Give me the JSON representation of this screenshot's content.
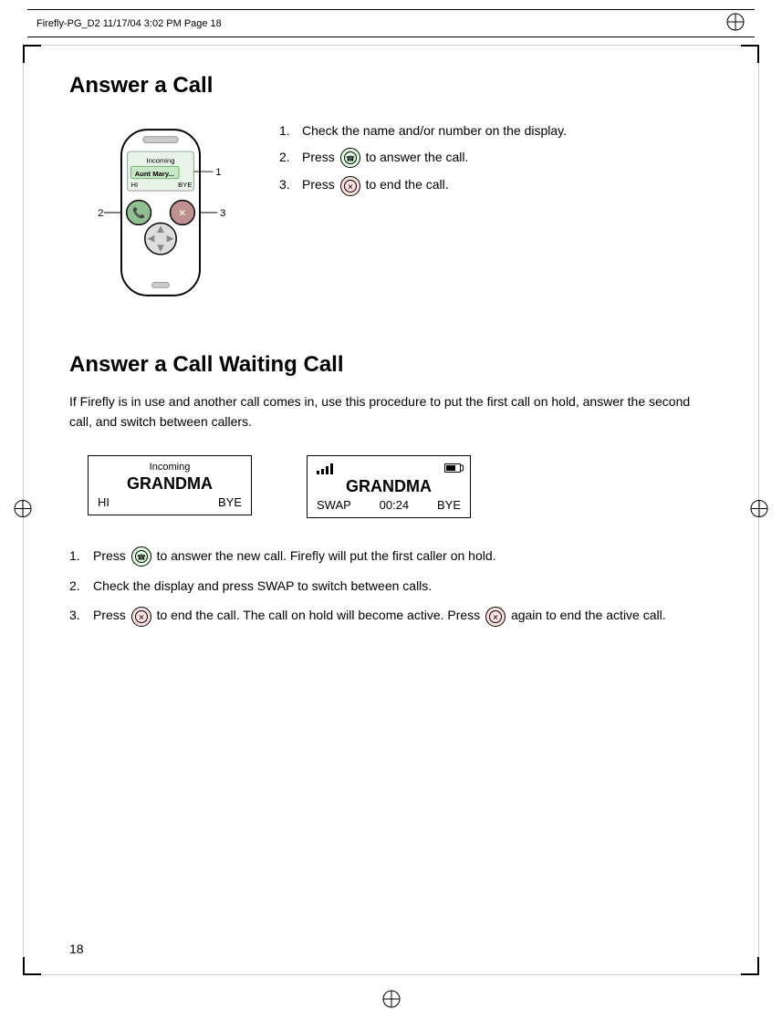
{
  "header": {
    "text": "Firefly-PG_D2  11/17/04  3:02 PM  Page 18"
  },
  "section1": {
    "title": "Answer a Call",
    "step1": "Check the name and/or number on the display.",
    "step2_prefix": "Press",
    "step2_suffix": "to answer the call.",
    "step3_prefix": "Press",
    "step3_suffix": "to end the call."
  },
  "section2": {
    "title": "Answer a Call Waiting Call",
    "description": "If Firefly is in use and another call comes in, use this procedure to put the first call on hold, answer the second call, and switch between callers.",
    "screen1": {
      "label": "Incoming",
      "name": "GRANDMA",
      "left": "HI",
      "right": "BYE"
    },
    "screen2": {
      "name": "GRANDMA",
      "time": "00:24",
      "swap": "SWAP",
      "bye": "BYE"
    },
    "step1_prefix": "Press",
    "step1_suffix": "to answer the new call. Firefly will put the first caller on hold.",
    "step2": "Check the display and press SWAP to switch between calls.",
    "step3_prefix": "Press",
    "step3_mid": "to end the call. The call on hold will become active. Press",
    "step3_suffix": "again to end the active call."
  },
  "phone_display": {
    "incoming_label": "Incoming",
    "contact_name": "Aunt Mary...",
    "labels": {
      "label1": "1",
      "label2": "2",
      "label3": "3"
    }
  },
  "page_number": "18"
}
